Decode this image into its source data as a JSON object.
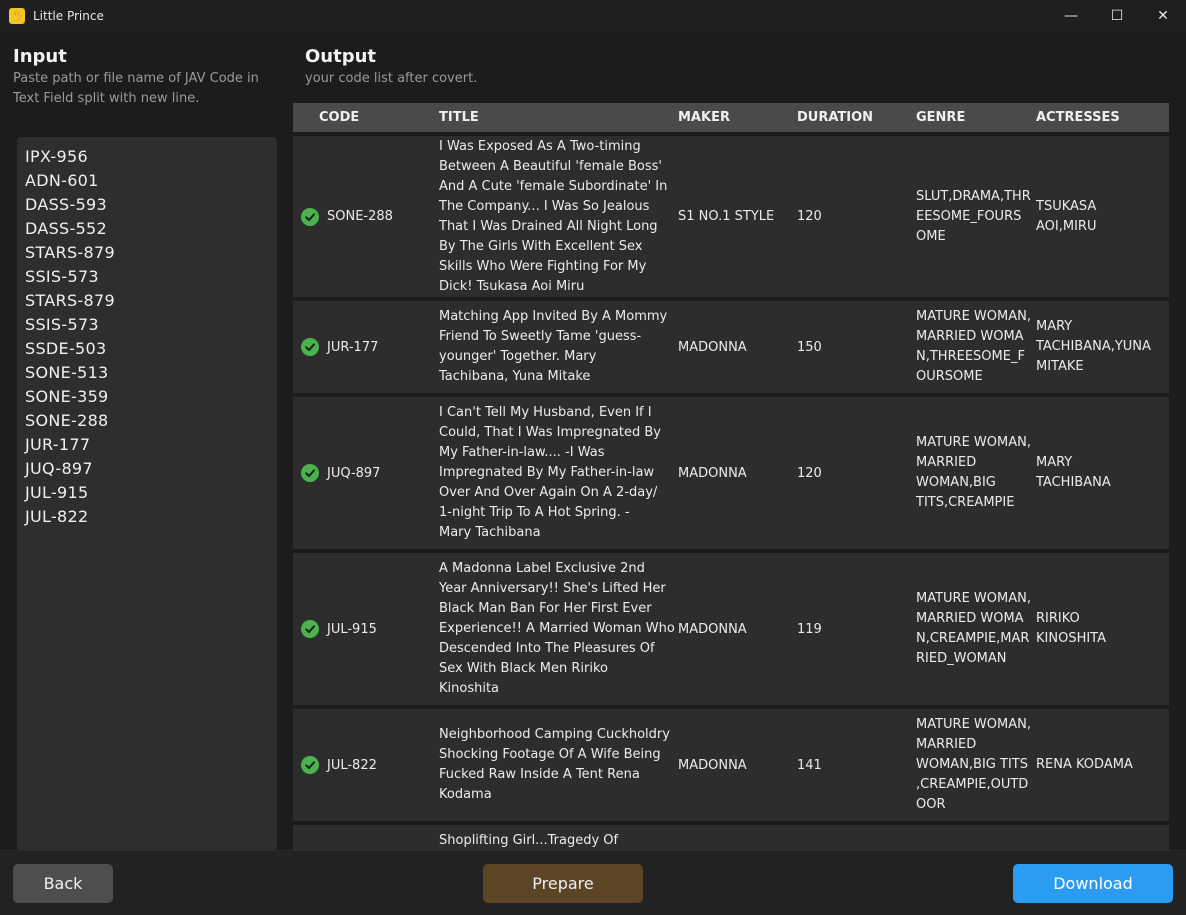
{
  "window": {
    "title": "Little Prince",
    "icon": "prince-app-icon",
    "minimize": "—",
    "maximize": "☐",
    "close": "✕"
  },
  "input": {
    "title": "Input",
    "subtitle_1": "Paste path or file name of JAV Code in",
    "subtitle_2": "Text Field split with new line.",
    "codes": [
      "IPX-956",
      "ADN-601",
      "DASS-593",
      "DASS-552",
      "STARS-879",
      "SSIS-573",
      "STARS-879",
      "SSIS-573",
      "SSDE-503",
      "SONE-513",
      "SONE-359",
      "SONE-288",
      "JUR-177",
      "JUQ-897",
      "JUL-915",
      "JUL-822"
    ]
  },
  "output": {
    "title": "Output",
    "subtitle": "your code list after covert.",
    "columns": {
      "code": "CODE",
      "title": "TITLE",
      "maker": "MAKER",
      "duration": "DURATION",
      "genre": "GENRE",
      "actresses": "ACTRESSES"
    },
    "rows": [
      {
        "status": "success",
        "code": "SONE-288",
        "title": [
          "I Was Exposed As A Two-timing",
          "Between A Beautiful 'female Boss'",
          "And A Cute 'female Subordinate' In",
          "The Company... I Was So Jealous",
          "That I Was Drained All Night Long",
          "By The Girls With Excellent Sex",
          "Skills Who Were Fighting For My",
          "Dick! Tsukasa Aoi Miru"
        ],
        "maker": "S1 NO.1 STYLE",
        "duration": "120",
        "genre": [
          "SLUT,DRAMA,THR",
          "EESOME_FOURS",
          "OME"
        ],
        "actresses": [
          "TSUKASA",
          "AOI,MIRU"
        ]
      },
      {
        "status": "success",
        "code": "JUR-177",
        "title": [
          "Matching App Invited By A Mommy",
          "Friend To Sweetly Tame 'guess-",
          "younger' Together. Mary",
          "Tachibana, Yuna Mitake"
        ],
        "maker": "MADONNA",
        "duration": "150",
        "genre": [
          "MATURE WOMAN,",
          "MARRIED WOMA",
          "N,THREESOME_F",
          "OURSOME"
        ],
        "actresses": [
          "MARY",
          "TACHIBANA,YUNA",
          "MITAKE"
        ]
      },
      {
        "status": "success",
        "code": "JUQ-897",
        "title": [
          "I Can't Tell My Husband, Even If I",
          "Could, That I Was Impregnated By",
          "My Father-in-law.... -I Was",
          "Impregnated By My Father-in-law",
          "Over And Over Again On A 2-day/",
          "1-night Trip To A Hot Spring. -",
          "Mary Tachibana"
        ],
        "maker": "MADONNA",
        "duration": "120",
        "genre": [
          "MATURE WOMAN,",
          "MARRIED",
          "WOMAN,BIG",
          "TITS,CREAMPIE"
        ],
        "actresses": [
          "MARY",
          "TACHIBANA"
        ]
      },
      {
        "status": "success",
        "code": "JUL-915",
        "title": [
          "A Madonna Label Exclusive 2nd",
          "Year Anniversary!! She's Lifted Her",
          "Black Man Ban For Her First Ever",
          "Experience!! A Married Woman Who",
          "Descended Into The Pleasures Of",
          "Sex With Black Men Ririko",
          "Kinoshita"
        ],
        "maker": "MADONNA",
        "duration": "119",
        "genre": [
          "MATURE WOMAN,",
          "MARRIED WOMA",
          "N,CREAMPIE,MAR",
          "RIED_WOMAN"
        ],
        "actresses": [
          "RIRIKO",
          "KINOSHITA"
        ]
      },
      {
        "status": "success",
        "code": "JUL-822",
        "title": [
          "Neighborhood Camping Cuckholdry",
          "Shocking Footage Of A Wife Being",
          "Fucked Raw Inside A Tent Rena",
          "Kodama"
        ],
        "maker": "MADONNA",
        "duration": "141",
        "genre": [
          "MATURE WOMAN,",
          "MARRIED",
          "WOMAN,BIG TITS",
          ",CREAMPIE,OUTD",
          "OOR"
        ],
        "actresses": [
          "RENA KODAMA"
        ]
      },
      {
        "status": "",
        "code": "",
        "title": [
          "Shoplifting Girl...Tragedy Of"
        ],
        "maker": "",
        "duration": "",
        "genre": [],
        "actresses": []
      }
    ]
  },
  "footer": {
    "back_label": "Back",
    "prepare_label": "Prepare",
    "download_label": "Download"
  },
  "colors": {
    "accent": "#2b9cf2",
    "prepare": "#5c4524",
    "success": "#4bb34b"
  }
}
